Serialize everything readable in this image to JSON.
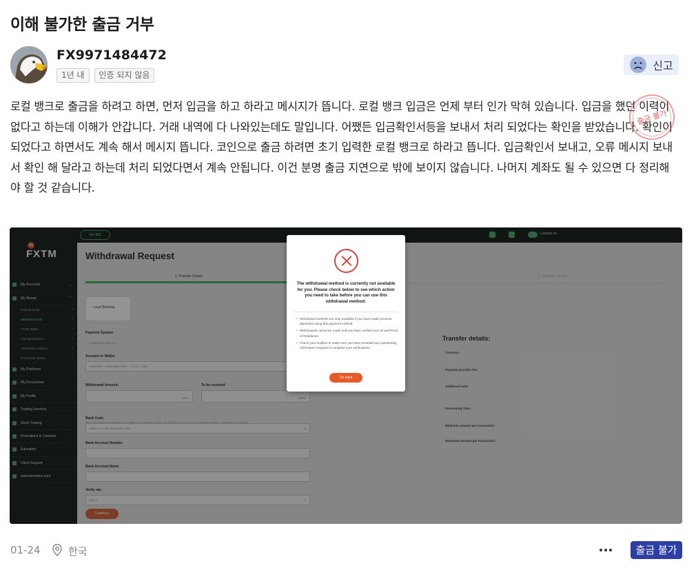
{
  "post": {
    "title": "이해 불가한 출금 거부",
    "username": "FX9971484472",
    "badges": [
      "1년 내",
      "인증 되지 않음"
    ],
    "report_label": "신고",
    "stamp_text": "출금 불가",
    "body": "로컬 뱅크로 출금을 하려고 하면, 먼저 입금을 하고 하라고 메시지가 뜹니다. 로컬 뱅크 입금은 언제 부터 인가 막혀 있습니다. 입금을 했던 이력이 없다고 하는데 이해가 안갑니다. 거래 내역에 다 나와있는데도 말입니다. 어쨌든 입금확인서등을 보내서 처리 되었다는 확인을 받았습니다. 확인이 되었다고 하면서도 계속 해서 메시지 뜹니다. 코인으로 출금 하려면 초기 입력한 로컬 뱅크로 하라고 뜹니다. 입금확인서 보내고, 오류 메시지 보내서 확인 해 달라고 하는데 처리 되었다면서 계속 안됩니다. 이건 분명 출금 지연으로 밖에 보이지 않습니다. 나머지 계좌도 될 수 있으면 다 정리해야 할 것 같습니다.",
    "date": "01-24",
    "location": "한국",
    "tag_label": "출금 불가"
  },
  "screenshot": {
    "logo_my": "My",
    "logo": "FXTM",
    "get_label": "Get $50",
    "contact_label": "Contact us",
    "nav": [
      {
        "label": "My Accounts",
        "chev": "⌄"
      },
      {
        "label": "My Money",
        "chev": "⌃"
      }
    ],
    "sub_nav": [
      {
        "label": "Deposit funds",
        "active": false
      },
      {
        "label": "Withdraw funds",
        "active": true
      },
      {
        "label": "FXTM Wallet",
        "active": false
      },
      {
        "label": "Internal transfers",
        "active": false
      },
      {
        "label": "Transaction History",
        "active": false
      },
      {
        "label": "Conversion Rates",
        "active": false
      }
    ],
    "nav2": [
      "My Platforms",
      "My Documents",
      "My Profile",
      "Trading Services",
      "Stock Trading",
      "Promotions & Contests",
      "Education",
      "Client Support",
      "www.forextime.com"
    ],
    "page_title": "Withdrawal Request",
    "step1": "1. Transfer Details",
    "step2": "2. Confirm Transfer",
    "local_banking": "Local Banking",
    "payment_system_label": "Payment System",
    "payment_system_value": "Local Bank Deposit",
    "account_label": "Account or Wallet",
    "account_value": "11x00000 - Advantage MT4 - 1 07.21 USD",
    "withdrawal_amount_label": "Withdrawal Amount:",
    "to_be_received_label": "To be received",
    "currency_from": "USD",
    "currency_to": "KRW",
    "note": "The USD amount indicated is subject to exchange rates. The final amount may be slightly smaller or bigger as a result.",
    "bank_code_label": "Bank Code",
    "bank_code_placeholder": "Select or enter the Bank Code",
    "bank_account_number_label": "Bank Account Number",
    "bank_account_name_label": "Bank Account Name",
    "verify_label": "Verify via:",
    "verify_value": "Select",
    "continue_label": "Continue",
    "transfer_details_title": "Transfer details:",
    "transfer_rows": [
      "Currency:",
      "Payment provider fee:",
      "Additional note:",
      "Processing Time:",
      "Minimum amount per transaction:",
      "Maximum amount per transaction:"
    ]
  },
  "modal": {
    "heading": "The withdrawal method is currently not available for you. Please check below to see which action you need to take before you can use this withdrawal method:",
    "items": [
      "Withdrawal methods are only available if you have made previous deposit(s) using this payment method.",
      "Withdrawals cannot be made until you have verified your ID and Proof of Residence.",
      "Check your mailbox to make sure you have provided any outstanding information required to complete your verifications."
    ],
    "back_label": "Go back"
  },
  "colors": {
    "tag_bg": "#2d3fa4",
    "report_bg": "#eaf0fb",
    "fxtm_green": "#3ba35d",
    "modal_error": "#d8433d",
    "go_back": "#e7582a"
  }
}
